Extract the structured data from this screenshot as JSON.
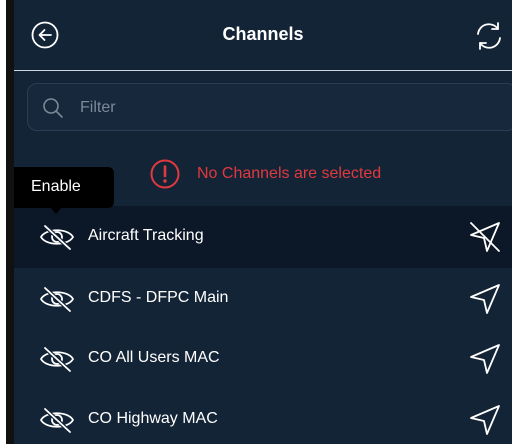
{
  "header": {
    "title": "Channels",
    "back_icon": "arrow-left-circle-icon",
    "refresh_icon": "refresh-icon"
  },
  "search": {
    "placeholder": "Filter",
    "value": ""
  },
  "warning": {
    "text": "No Channels are selected",
    "color": "#e0393e"
  },
  "tooltip": {
    "text": "Enable"
  },
  "channels": [
    {
      "label": "Aircraft Tracking",
      "visibility_icon": "eye-slash-icon",
      "action_icon": "send-slash-icon",
      "active": true
    },
    {
      "label": "CDFS - DFPC Main",
      "visibility_icon": "eye-slash-icon",
      "action_icon": "send-icon",
      "active": false
    },
    {
      "label": "CO All Users MAC",
      "visibility_icon": "eye-slash-icon",
      "action_icon": "send-icon",
      "active": false
    },
    {
      "label": "CO Highway MAC",
      "visibility_icon": "eye-slash-icon",
      "action_icon": "send-icon",
      "active": false
    }
  ],
  "colors": {
    "background": "#142437",
    "active_row": "#0c1828",
    "text": "#ffffff",
    "accent_red": "#e0393e"
  }
}
